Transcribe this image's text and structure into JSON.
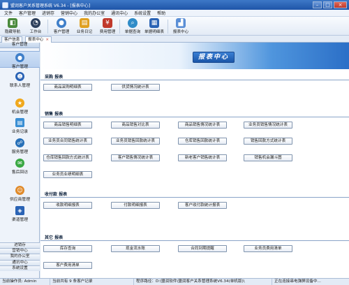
{
  "window": {
    "title": "盟润客户关系管理系统 V6.34 - [报表中心]"
  },
  "menu": [
    "文件",
    "客户管理",
    "进销存",
    "营销中心",
    "我的办公室",
    "通讯中心",
    "系统设置",
    "帮助"
  ],
  "toolbar": [
    {
      "label": "隐藏导航",
      "icon": "hide-nav-icon"
    },
    {
      "label": "工作台",
      "icon": "workbench-icon"
    },
    {
      "label": "客户管理",
      "icon": "customer-icon"
    },
    {
      "label": "业务日记",
      "icon": "diary-icon"
    },
    {
      "label": "费用管理",
      "icon": "expense-icon"
    },
    {
      "label": "单据查询",
      "icon": "search-icon"
    },
    {
      "label": "单据明细表",
      "icon": "detail-icon"
    },
    {
      "label": "报表中心",
      "icon": "report-icon"
    }
  ],
  "tabs": [
    {
      "label": "客户信息"
    },
    {
      "label": "报表中心",
      "close": "×"
    }
  ],
  "sidebar": {
    "header": "客户管理",
    "items": [
      {
        "label": "客户管理",
        "icon": "customer-icon"
      },
      {
        "label": "联系人管理",
        "icon": "contact-icon"
      },
      {
        "label": "机会管理",
        "icon": "star-icon"
      },
      {
        "label": "业务记录",
        "icon": "record-icon"
      },
      {
        "label": "服务管理",
        "icon": "service-icon"
      },
      {
        "label": "售后回访",
        "icon": "visit-icon"
      },
      {
        "label": "供应商管理",
        "icon": "supplier-icon"
      },
      {
        "label": "渠道管理",
        "icon": "channel-icon"
      }
    ],
    "bottom": [
      "进销存",
      "营销中心",
      "我的办公室",
      "通讯中心",
      "系统设置"
    ]
  },
  "main": {
    "banner": "报表中心",
    "sections": [
      {
        "title": "采购 报表",
        "buttons": [
          "商品采购明细表",
          "供货情况统计表"
        ]
      },
      {
        "title": "销售 报表",
        "buttons": [
          "商品销售明细表",
          "商品销售对比表",
          "商品销售情况统计表",
          "业务员销售情况统计表",
          "业务员合同销售统计表",
          "业务员销售回款统计表",
          "仓库销售回款统计表",
          "销售回款方式统计表",
          "仓库销售回款方式统计表",
          "客户销售情况统计表",
          "新老客户销售统计表",
          "销售机会漏斗图",
          "业务员业绩明细表"
        ]
      },
      {
        "title": "收付款 报表",
        "buttons": [
          "收款明细报表",
          "付款明细报表",
          "客户收付款统计报表"
        ]
      },
      {
        "title": "其它 报表",
        "buttons": [
          "库存查询",
          "现金流水账",
          "合同到期提醒",
          "业务员费用清单",
          "客户费用清单"
        ]
      }
    ]
  },
  "status": [
    "当前操作员: Admin",
    "当前共有 9 条客户记录",
    "程序路径：D:\\盟润软件\\盟润客户关系管理系统V6.34(单机版)\\",
    "正在连接串电弹屏设备中..."
  ],
  "colors": {
    "title": "#2a63b5",
    "accent": "#3a7fd4"
  }
}
